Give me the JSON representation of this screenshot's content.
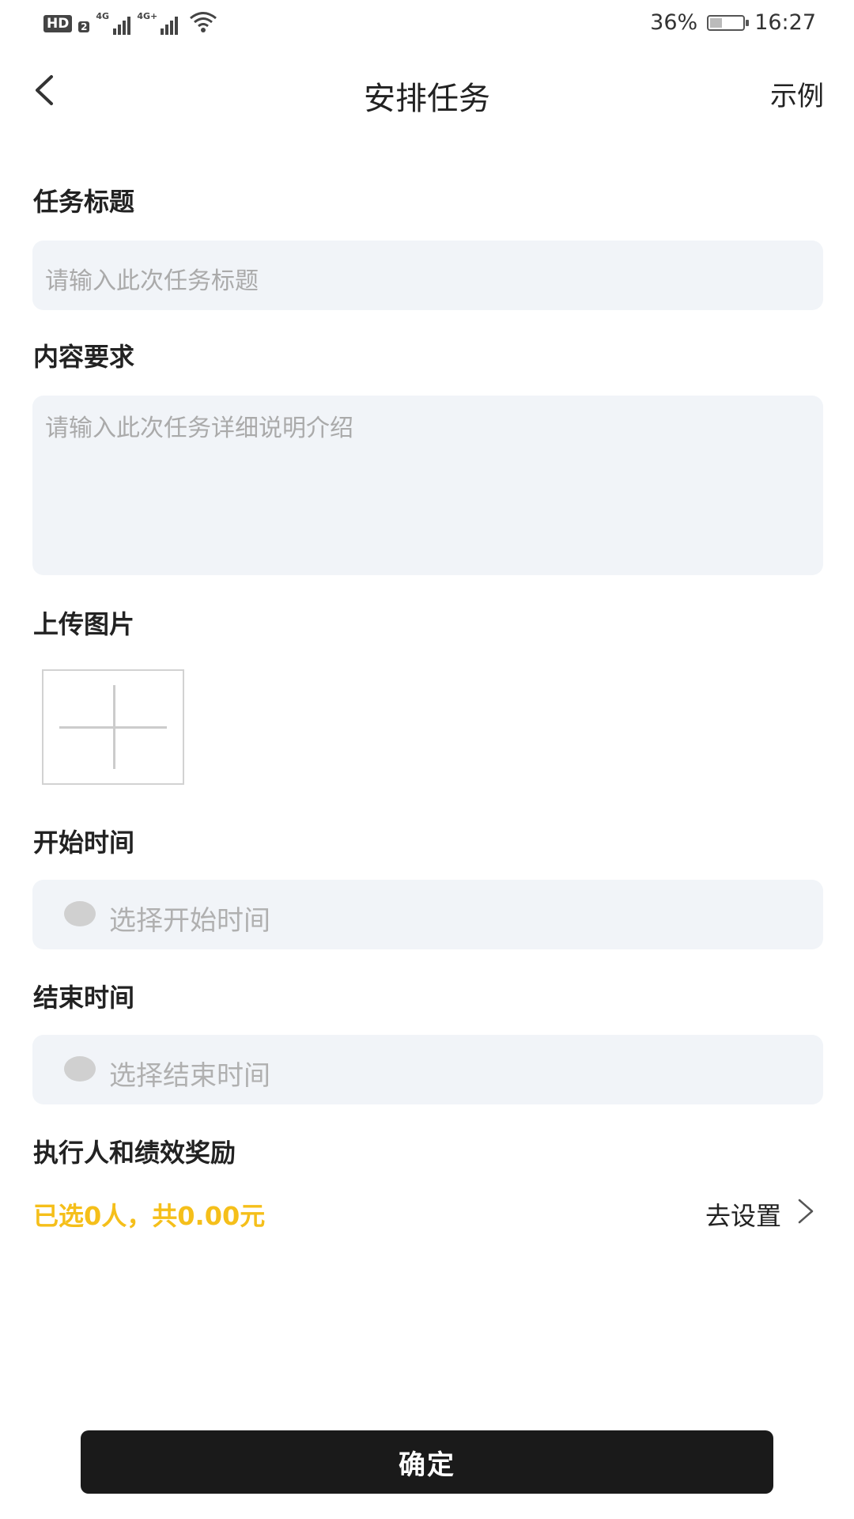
{
  "status_bar": {
    "hd_label": "HD",
    "hd_sub": "2",
    "signal1_tag": "4G",
    "signal2_tag": "4G+",
    "battery_percent": "36%",
    "battery_level": 0.36,
    "time": "16:27"
  },
  "header": {
    "title": "安排任务",
    "action": "示例"
  },
  "form": {
    "task_title": {
      "label": "任务标题",
      "placeholder": "请输入此次任务标题"
    },
    "content": {
      "label": "内容要求",
      "placeholder": "请输入此次任务详细说明介绍"
    },
    "upload": {
      "label": "上传图片"
    },
    "start_time": {
      "label": "开始时间",
      "placeholder": "选择开始时间"
    },
    "end_time": {
      "label": "结束时间",
      "placeholder": "选择结束时间"
    },
    "assignees": {
      "label": "执行人和绩效奖励",
      "summary": "已选0人，共0.00元",
      "action": "去设置"
    }
  },
  "footer": {
    "confirm_label": "确定"
  },
  "colors": {
    "accent": "#f5bf1a",
    "button_bg": "#1a1a1a",
    "field_bg": "#f1f4f8"
  }
}
